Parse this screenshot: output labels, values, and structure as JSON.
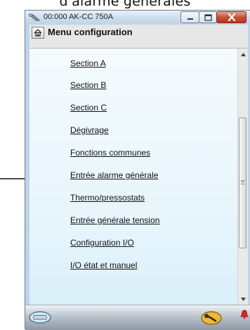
{
  "caption": "d'alarme générales",
  "window": {
    "title": "00:000 AK-CC 750A",
    "controls": {
      "minimize": "minimize",
      "maximize": "maximize",
      "close": "close"
    }
  },
  "header": {
    "title": "Menu configuration",
    "home_icon": "home-icon"
  },
  "menu": {
    "items": [
      {
        "label": "Section A"
      },
      {
        "label": "Section B"
      },
      {
        "label": "Section C"
      },
      {
        "label": "Dégivrage"
      },
      {
        "label": "Fonctions communes"
      },
      {
        "label": "Entrée alarme générale"
      },
      {
        "label": "Thermo/pressostats"
      },
      {
        "label": "Entrée générale tension"
      },
      {
        "label": "Configuration I/O"
      },
      {
        "label": "I/O  état et manuel"
      }
    ]
  },
  "footer": {
    "left_icon": "network-device-icon",
    "right_icon": "wrench-icon",
    "alarm_icon": "alarm-bell-icon"
  },
  "colors": {
    "window_frame": "#bdd5ea",
    "content_bg": "#e6f5fc",
    "close_button": "#c9503a",
    "alarm": "#e02020",
    "wrench": "#e0a020"
  }
}
